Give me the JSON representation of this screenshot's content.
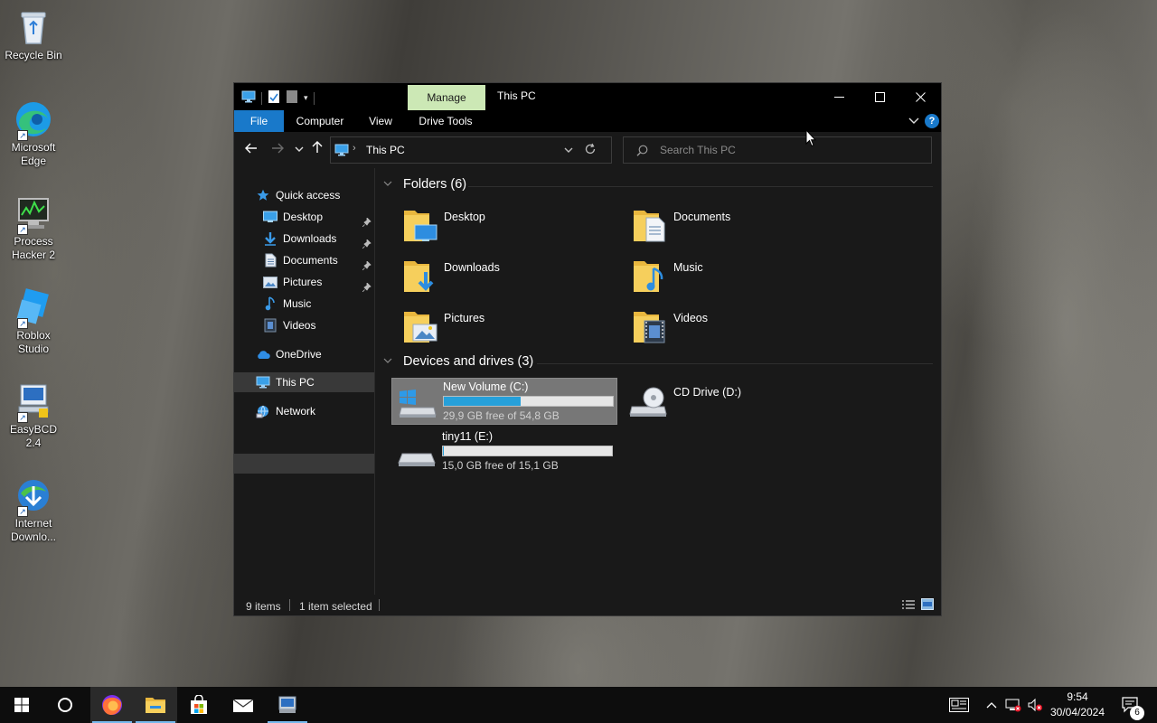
{
  "desktop": {
    "icons": [
      {
        "label": "Recycle Bin"
      },
      {
        "label": "Microsoft Edge"
      },
      {
        "label": "Process Hacker 2"
      },
      {
        "label": "Roblox Studio"
      },
      {
        "label": "EasyBCD 2.4"
      },
      {
        "label": "Internet Downlo..."
      }
    ]
  },
  "window": {
    "title": "This PC",
    "context_tab": "Manage",
    "ribbon_tabs": [
      "File",
      "Computer",
      "View",
      "Drive Tools"
    ],
    "address": {
      "location": "This PC"
    },
    "search": {
      "placeholder": "Search This PC"
    },
    "sidebar": {
      "quick_access": "Quick access",
      "quick_items": [
        "Desktop",
        "Downloads",
        "Documents",
        "Pictures",
        "Music",
        "Videos"
      ],
      "onedrive": "OneDrive",
      "this_pc": "This PC",
      "network": "Network"
    },
    "folders": {
      "header": "Folders (6)",
      "items": [
        "Desktop",
        "Documents",
        "Downloads",
        "Music",
        "Pictures",
        "Videos"
      ]
    },
    "drives": {
      "header": "Devices and drives (3)",
      "items": [
        {
          "name": "New Volume (C:)",
          "free": "29,9 GB free of 54,8 GB",
          "used_fraction": 0.454
        },
        {
          "name": "CD Drive (D:)"
        },
        {
          "name": "tiny11 (E:)",
          "free": "15,0 GB free of 15,1 GB",
          "used_fraction": 0.007
        }
      ]
    },
    "status": {
      "items": "9 items",
      "selected": "1 item selected"
    }
  },
  "taskbar": {
    "time": "9:54",
    "date": "30/04/2024",
    "notifications": "6"
  },
  "colors": {
    "accent": "#1979ca",
    "manage_tab": "#cce8b5",
    "drive_fill": "#26a0da",
    "folder": "#f2c44d"
  }
}
